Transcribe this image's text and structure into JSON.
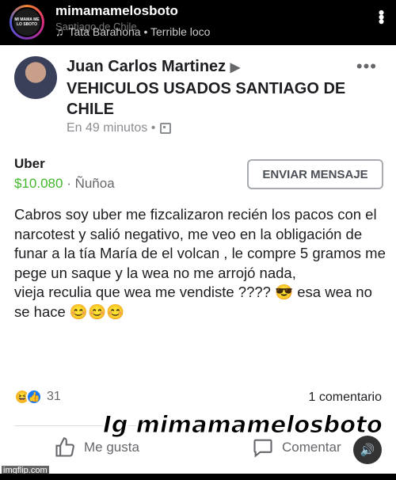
{
  "ig": {
    "avatar_text": "MI MAMA ME LO SBOTO",
    "username": "mimamamelosboto",
    "location": "Santiago de Chile",
    "music": "Tata Barahona • Terrible loco"
  },
  "post": {
    "author": "Juan Carlos Martinez",
    "group": "VEHICULOS USADOS SANTIAGO DE CHILE",
    "time": "En 49 minutos •",
    "listing_title": "Uber",
    "price": "$10.080",
    "location": "Ñuñoa",
    "send_button": "ENVIAR MENSAJE",
    "body": "Cabros soy uber me fizcalizaron recién los pacos con el narcotest y salió negativo, me veo en la obligación de funar a la tía María de el volcan , le compre 5 gramos me pege un saque y la wea no me arrojó nada,\nvieja reculia que wea me vendiste ???? 😎 esa wea no se hace 😊😊😊",
    "reaction_count": "31",
    "comments": "1 comentario",
    "like_label": "Me gusta",
    "comment_label": "Comentar"
  },
  "watermark": "Ig mimamamelosboto",
  "imgflip": "imgflip.com",
  "colors": {
    "price": "#42b72a",
    "like_blue": "#1877f2",
    "haha_yellow": "#f7b928"
  }
}
